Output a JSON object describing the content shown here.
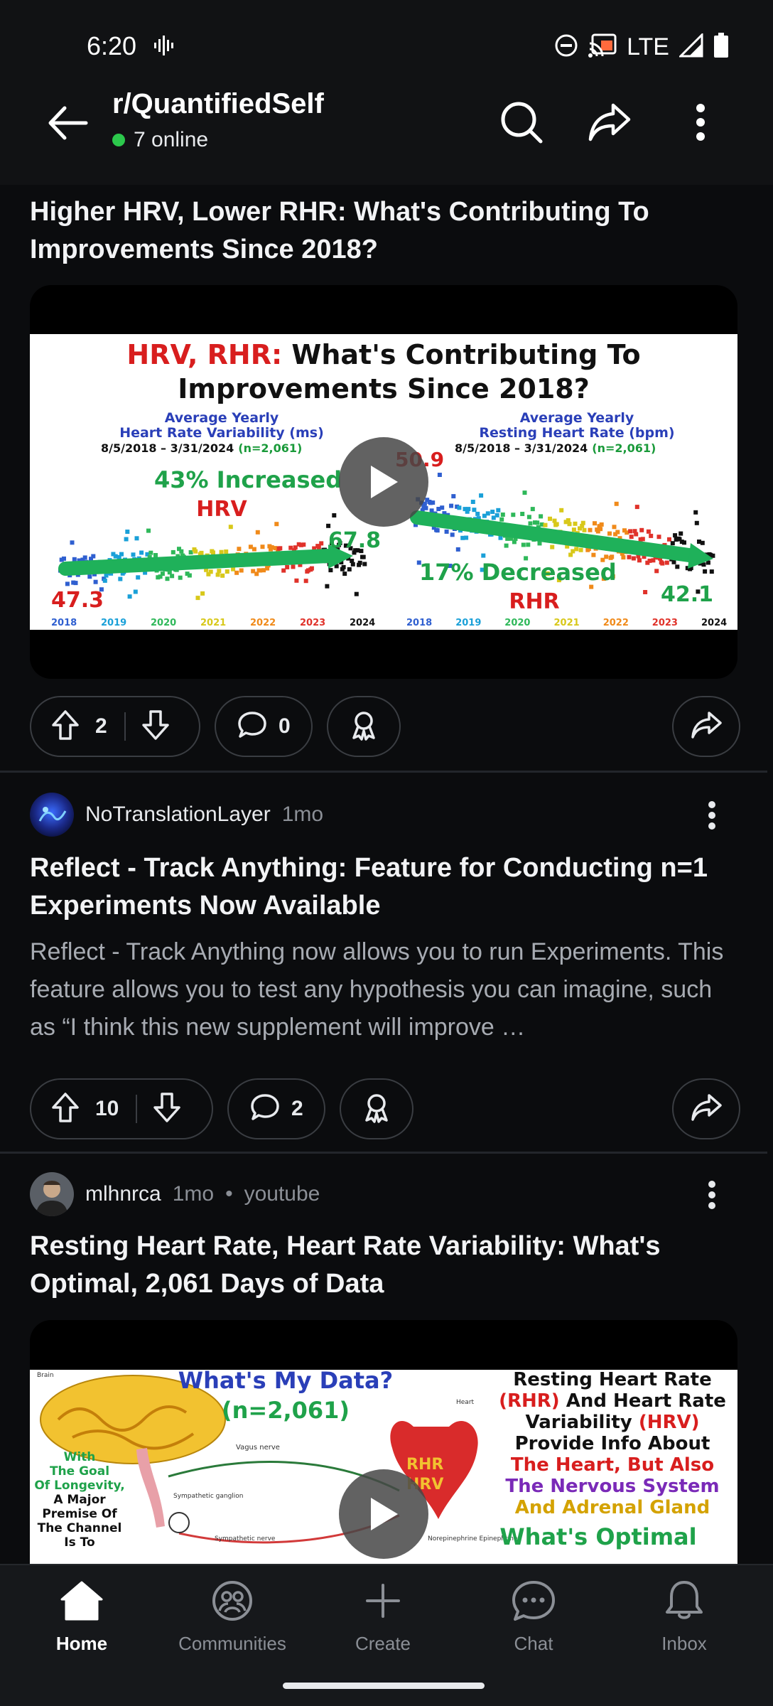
{
  "status_bar": {
    "time": "6:20",
    "network": "LTE"
  },
  "header": {
    "subreddit": "r/QuantifiedSelf",
    "online": "7 online"
  },
  "posts": [
    {
      "title": "Higher HRV, Lower RHR: What's Contributing To Improvements Since 2018?",
      "thumbnail": {
        "headline_red": "HRV, RHR:",
        "headline_black": " What's Contributing To",
        "headline_line2": "Improvements Since 2018?",
        "left_chart_title1": "Average Yearly",
        "left_chart_title2": "Heart Rate Variability (ms)",
        "left_chart_dates": "8/5/2018 – 3/31/2024",
        "left_chart_n": "(n=2,061)",
        "right_chart_title1": "Average Yearly",
        "right_chart_title2": "Resting Heart Rate (bpm)",
        "right_chart_dates": "8/5/2018 – 3/31/2024",
        "right_chart_n": "(n=2,061)",
        "increase_text": "43% Increased",
        "increase_label": "HRV",
        "decrease_text": "17% Decreased",
        "decrease_label": "RHR",
        "hrv_start": "47.3",
        "hrv_end": "67.8",
        "rhr_start": "50.9",
        "rhr_end": "42.1",
        "years": [
          "2018",
          "2019",
          "2020",
          "2021",
          "2022",
          "2023",
          "2024"
        ]
      },
      "votes": "2",
      "comments": "0"
    },
    {
      "author": "NoTranslationLayer",
      "age": "1mo",
      "title": "Reflect - Track Anything: Feature for Conducting n=1 Experiments Now Available",
      "body": "Reflect - Track Anything now allows you to run Experiments. This feature allows you to test any hypothesis you can imagine, such as “I think this new supplement will improve …",
      "votes": "10",
      "comments": "2"
    },
    {
      "author": "mlhnrca",
      "age": "1mo",
      "source": "youtube",
      "title": "Resting Heart Rate, Heart Rate Variability: What's Optimal, 2,061 Days of Data",
      "thumbnail": {
        "center_title": "What's My Data?",
        "center_n": "(n=2,061)",
        "left_text": "With The Goal Of Longevity, A Major Premise Of The Channel Is To",
        "right_line1": "Resting Heart Rate",
        "right_line2a": "(RHR)",
        "right_line2b": " And Heart Rate",
        "right_line3a": "Variability ",
        "right_line3b": "(HRV)",
        "right_line4": "Provide Info About",
        "right_line5": "The Heart, But Also",
        "right_line6": "The Nervous System",
        "right_line7": "And Adrenal Gland",
        "bottom_text": "What's Optimal",
        "heart_rhr": "RHR",
        "heart_hrv": "HRV",
        "label_brain": "Brain",
        "label_heart": "Heart",
        "label_vagus": "Vagus nerve",
        "label_symp_ganglion": "Sympathetic ganglion",
        "label_symp_nerve": "Sympathetic nerve",
        "label_norepi": "Norepinephrine Epinephrine"
      }
    }
  ],
  "bottom_nav": [
    {
      "label": "Home",
      "icon": "home-icon",
      "active": true
    },
    {
      "label": "Communities",
      "icon": "communities-icon",
      "active": false
    },
    {
      "label": "Create",
      "icon": "plus-icon",
      "active": false
    },
    {
      "label": "Chat",
      "icon": "chat-icon",
      "active": false
    },
    {
      "label": "Inbox",
      "icon": "bell-icon",
      "active": false
    }
  ],
  "colors": {
    "accent_online": "#2cc84c",
    "background": "#0b0c0e",
    "header": "#111214"
  }
}
